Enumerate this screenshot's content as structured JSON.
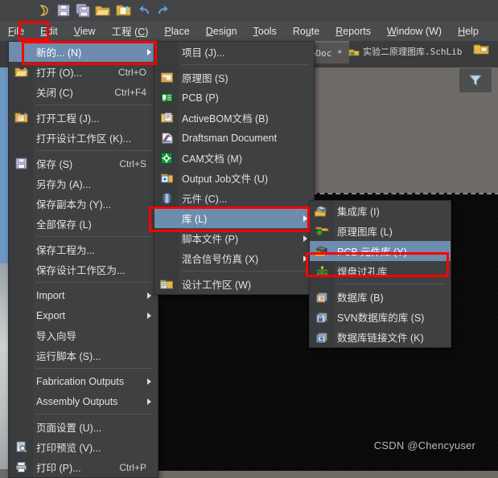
{
  "app": {
    "toolbar_icons": [
      "altium-logo-icon",
      "save-icon",
      "save-all-icon",
      "open-folder-icon",
      "open-project-icon",
      "undo-icon",
      "redo-icon"
    ]
  },
  "menubar": {
    "items": [
      {
        "label": "File",
        "mnemonic": "F",
        "active": true
      },
      {
        "label": "Edit",
        "mnemonic": "E",
        "active": false
      },
      {
        "label": "View",
        "mnemonic": "V",
        "active": false
      },
      {
        "label": "工程 (C)",
        "mnemonic": "C",
        "active": false
      },
      {
        "label": "Place",
        "mnemonic": "P",
        "active": false
      },
      {
        "label": "Design",
        "mnemonic": "D",
        "active": false
      },
      {
        "label": "Tools",
        "mnemonic": "T",
        "active": false
      },
      {
        "label": "Route",
        "mnemonic": "u",
        "active": false
      },
      {
        "label": "Reports",
        "mnemonic": "R",
        "active": false
      },
      {
        "label": "Window (W)",
        "mnemonic": "W",
        "active": false
      },
      {
        "label": "Help",
        "mnemonic": "H",
        "active": false
      }
    ]
  },
  "tabs": [
    {
      "label": "图.PcbDoc *",
      "selected": true,
      "icon": "pcb-doc-icon"
    },
    {
      "label": "实验二原理图库.SchLib",
      "selected": false,
      "icon": "schlib-icon"
    }
  ],
  "filter_button": {
    "icon": "filter-funnel-icon"
  },
  "file_menu": {
    "items": [
      {
        "label": "新的... (N)",
        "shortcut": "",
        "icon": "",
        "submenu": true,
        "highlight": true,
        "redbox": true
      },
      {
        "label": "打开 (O)...",
        "shortcut": "Ctrl+O",
        "icon": "open-folder-icon",
        "submenu": false
      },
      {
        "label": "关闭 (C)",
        "shortcut": "Ctrl+F4",
        "icon": "",
        "submenu": false
      },
      {
        "sep": true
      },
      {
        "label": "打开工程 (J)...",
        "shortcut": "",
        "icon": "open-project-icon",
        "submenu": false
      },
      {
        "label": "打开设计工作区 (K)...",
        "shortcut": "",
        "icon": "",
        "submenu": false
      },
      {
        "sep": true
      },
      {
        "label": "保存 (S)",
        "shortcut": "Ctrl+S",
        "icon": "save-icon",
        "submenu": false
      },
      {
        "label": "另存为 (A)...",
        "shortcut": "",
        "icon": "",
        "submenu": false
      },
      {
        "label": "保存副本为 (Y)...",
        "shortcut": "",
        "icon": "",
        "submenu": false
      },
      {
        "label": "全部保存 (L)",
        "shortcut": "",
        "icon": "",
        "submenu": false
      },
      {
        "sep": true
      },
      {
        "label": "保存工程为...",
        "shortcut": "",
        "icon": "",
        "submenu": false
      },
      {
        "label": "保存设计工作区为...",
        "shortcut": "",
        "icon": "",
        "submenu": false
      },
      {
        "sep": true
      },
      {
        "label": "Import",
        "shortcut": "",
        "icon": "",
        "submenu": true
      },
      {
        "label": "Export",
        "shortcut": "",
        "icon": "",
        "submenu": true
      },
      {
        "label": "导入向导",
        "shortcut": "",
        "icon": "",
        "submenu": false
      },
      {
        "label": "运行脚本 (S)...",
        "shortcut": "",
        "icon": "",
        "submenu": false
      },
      {
        "sep": true
      },
      {
        "label": "Fabrication Outputs",
        "shortcut": "",
        "icon": "",
        "submenu": true
      },
      {
        "label": "Assembly Outputs",
        "shortcut": "",
        "icon": "",
        "submenu": true
      },
      {
        "sep": true
      },
      {
        "label": "页面设置 (U)...",
        "shortcut": "",
        "icon": "",
        "submenu": false
      },
      {
        "label": "打印预览 (V)...",
        "shortcut": "",
        "icon": "print-preview-icon",
        "submenu": false
      },
      {
        "label": "打印 (P)...",
        "shortcut": "Ctrl+P",
        "icon": "print-icon",
        "submenu": false
      }
    ]
  },
  "new_submenu": {
    "items": [
      {
        "label": "项目 (J)...",
        "icon": "",
        "submenu": false
      },
      {
        "sep": true
      },
      {
        "label": "原理图 (S)",
        "icon": "schematic-icon",
        "submenu": false
      },
      {
        "label": "PCB (P)",
        "icon": "pcb-icon",
        "submenu": false
      },
      {
        "label": "ActiveBOM文档 (B)",
        "icon": "activebom-icon",
        "submenu": false
      },
      {
        "label": "Draftsman Document",
        "icon": "draftsman-icon",
        "submenu": false
      },
      {
        "label": "CAM文档 (M)",
        "icon": "cam-icon",
        "submenu": false
      },
      {
        "label": "Output Job文件 (U)",
        "icon": "outputjob-icon",
        "submenu": false
      },
      {
        "label": "元件 (C)...",
        "icon": "component-icon",
        "submenu": false
      },
      {
        "label": "库 (L)",
        "icon": "",
        "submenu": true,
        "highlight": true,
        "redbox": true
      },
      {
        "label": "脚本文件 (P)",
        "icon": "",
        "submenu": true
      },
      {
        "label": "混合信号仿真 (X)",
        "icon": "",
        "submenu": true
      },
      {
        "sep": true
      },
      {
        "label": "设计工作区 (W)",
        "icon": "workspace-icon",
        "submenu": false
      }
    ]
  },
  "library_submenu": {
    "items": [
      {
        "label": "集成库 (I)",
        "icon": "integrated-lib-icon",
        "submenu": false
      },
      {
        "label": "原理图库 (L)",
        "icon": "sch-lib-icon",
        "submenu": false
      },
      {
        "label": "PCB 元件库 (Y)",
        "icon": "pcb-lib-icon",
        "submenu": false,
        "highlight": true,
        "redbox": true
      },
      {
        "label": "焊盘过孔库",
        "icon": "pad-via-lib-icon",
        "submenu": false
      },
      {
        "sep": true
      },
      {
        "label": "数据库 (B)",
        "icon": "database-icon",
        "submenu": false
      },
      {
        "label": "SVN数据库的库 (S)",
        "icon": "svn-database-icon",
        "submenu": false
      },
      {
        "label": "数据库链接文件 (K)",
        "icon": "database-link-icon",
        "submenu": false
      }
    ]
  },
  "watermark": {
    "text": "CSDN @Chencyuser"
  },
  "colors": {
    "menu_bg": "#3f4041",
    "menu_gutter": "#3a3b3c",
    "highlight": "#6d8cae",
    "redbox": "#ff0000",
    "workarea": "#6e6a66",
    "toolbar": "#434445",
    "text": "#e2e2e2"
  }
}
